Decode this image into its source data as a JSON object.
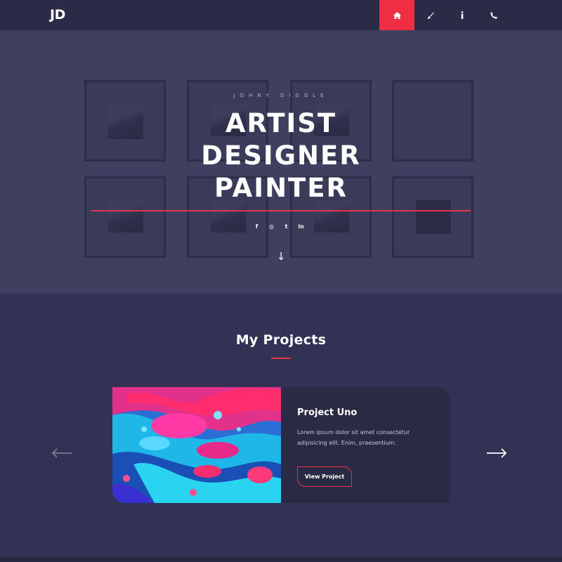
{
  "brand": {
    "logo_text": "JD"
  },
  "nav": {
    "items": [
      {
        "icon": "home-icon",
        "active": true
      },
      {
        "icon": "paintbrush-icon",
        "active": false
      },
      {
        "icon": "info-icon",
        "active": false
      },
      {
        "icon": "phone-icon",
        "active": false
      }
    ]
  },
  "hero": {
    "eyebrow": "JOHNY DIGGLE",
    "lines": [
      "ARTIST",
      "DESIGNER",
      "PAINTER"
    ],
    "socials": [
      {
        "icon": "facebook-icon",
        "glyph": "f"
      },
      {
        "icon": "instagram-icon",
        "glyph": "◎"
      },
      {
        "icon": "twitter-icon",
        "glyph": "t"
      },
      {
        "icon": "linkedin-icon",
        "glyph": "in"
      }
    ],
    "scroll_glyph": "↓"
  },
  "projects": {
    "title": "My Projects",
    "card": {
      "title": "Project Uno",
      "description": "Lorem ipsum dolor sit amet consectetur adipisicing elit. Enim, praesentium.",
      "button_label": "View Project"
    }
  },
  "colors": {
    "accent": "#ef2e43",
    "nav_bg": "#2b2b47",
    "hero_bg": "#3f3f5f",
    "projects_bg": "#323254",
    "card_bg": "#2a2a45"
  }
}
